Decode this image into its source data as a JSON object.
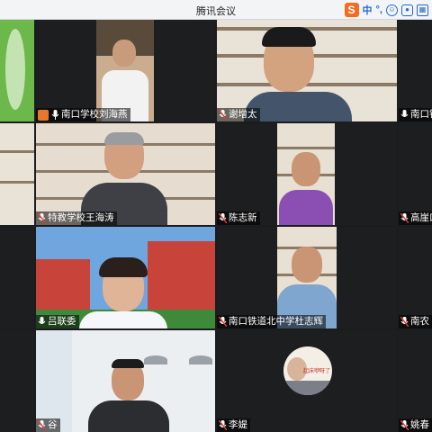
{
  "window": {
    "title": "腾讯会议"
  },
  "ime": {
    "logo": "S",
    "lang": "中",
    "punct": "°,"
  },
  "participants": [
    {
      "name": "南口学校刘海燕",
      "host": true,
      "muted": false
    },
    {
      "name": "谢增太",
      "muted": true
    },
    {
      "name": "南口铁",
      "muted": false
    },
    {
      "name": "特教学校王海涛",
      "muted": true
    },
    {
      "name": "陈志新",
      "muted": true
    },
    {
      "name": "高崖口",
      "muted": true
    },
    {
      "name": "吕联委",
      "muted": false
    },
    {
      "name": "南口铁道北中学杜志辉",
      "muted": true
    },
    {
      "name": "南农",
      "muted": true
    },
    {
      "name": "谷",
      "muted": true
    },
    {
      "name": "李媞",
      "muted": true
    },
    {
      "name": "姚春",
      "muted": true
    }
  ],
  "avatar_text": "起床咿呀了",
  "colors": {
    "host_badge": "#e8772e",
    "muted_mic": "#e03b3b",
    "ime_accent": "#2368d8"
  }
}
